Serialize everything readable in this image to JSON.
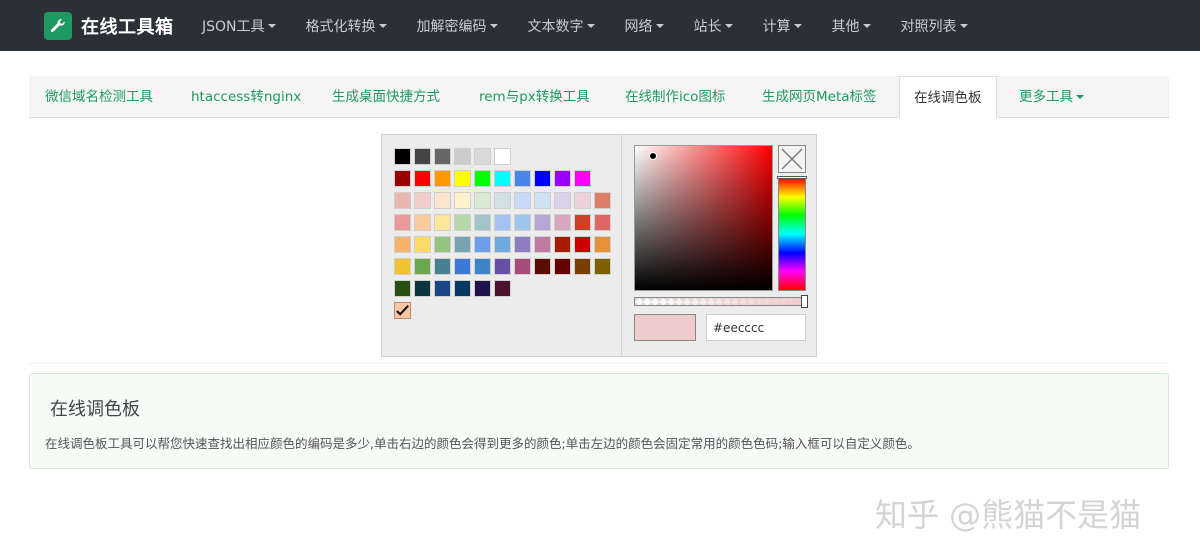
{
  "brand": {
    "name": "在线工具箱",
    "icon": "wrench-icon"
  },
  "nav": {
    "items": [
      {
        "label": "JSON工具",
        "id": "json"
      },
      {
        "label": "格式化转换",
        "id": "format"
      },
      {
        "label": "加解密编码",
        "id": "crypto"
      },
      {
        "label": "文本数字",
        "id": "text"
      },
      {
        "label": "网络",
        "id": "network"
      },
      {
        "label": "站长",
        "id": "webmaster"
      },
      {
        "label": "计算",
        "id": "calc"
      },
      {
        "label": "其他",
        "id": "other"
      },
      {
        "label": "对照列表",
        "id": "reference"
      }
    ]
  },
  "tabs": {
    "items": [
      {
        "label": "微信域名检测工具",
        "id": "wechat-domain"
      },
      {
        "label": "htaccess转nginx",
        "id": "htaccess"
      },
      {
        "label": "生成桌面快捷方式",
        "id": "shortcut"
      },
      {
        "label": "rem与px转换工具",
        "id": "rem-px"
      },
      {
        "label": "在线制作ico图标",
        "id": "ico"
      },
      {
        "label": "生成网页Meta标签",
        "id": "meta"
      },
      {
        "label": "在线调色板",
        "id": "palette",
        "active": true
      },
      {
        "label": "更多工具",
        "id": "more"
      }
    ]
  },
  "picker": {
    "selected_color": "#eecccc",
    "hex_value": "#eecccc",
    "rows": [
      [
        "#000000",
        "#444444",
        "#666666",
        "#cccccc",
        "#d9d9d9",
        "#ffffff"
      ],
      [
        "#990000",
        "#ff0000",
        "#ff9900",
        "#ffff00",
        "#00ff00",
        "#00ffff",
        "#4a86e8",
        "#0000ff",
        "#9900ff",
        "#ff00ff"
      ],
      [
        "#e6b8af",
        "#f4cccc",
        "#fce5cd",
        "#fff2cc",
        "#d9ead3",
        "#d0e0e3",
        "#c9daf8",
        "#cfe2f3",
        "#d9d2e9",
        "#ead1dc",
        "#dd7e6b"
      ],
      [
        "#ea9999",
        "#f9cb9c",
        "#ffe599",
        "#b6d7a8",
        "#a2c4c9",
        "#a4c2f4",
        "#9fc5e8",
        "#b4a7d6",
        "#d5a6bd",
        "#cc4125",
        "#e06666"
      ],
      [
        "#f6b26b",
        "#ffd966",
        "#93c47d",
        "#76a5af",
        "#6d9eeb",
        "#6fa8dc",
        "#8e7cc3",
        "#c27ba0",
        "#a61c00",
        "#cc0000",
        "#e69138"
      ],
      [
        "#f1c232",
        "#6aa84f",
        "#45818e",
        "#3c78d8",
        "#3d85c6",
        "#674ea7",
        "#a64d79",
        "#5b0f00",
        "#660000",
        "#783f04",
        "#7f6000"
      ],
      [
        "#274e13",
        "#0c343d",
        "#1c4587",
        "#073763",
        "#20124d",
        "#4c1130"
      ]
    ],
    "check_icon": "checkmark-icon",
    "clear_icon": "close-icon"
  },
  "info": {
    "title": "在线调色板",
    "description": "在线调色板工具可以帮您快速查找出相应颜色的编码是多少,单击右边的颜色会得到更多的颜色;单击左边的颜色会固定常用的颜色色码;输入框可以自定义颜色。"
  },
  "watermark": "知乎 @熊猫不是猫",
  "colors": {
    "accent": "#1d9a62",
    "navbar": "#2b2f36"
  }
}
